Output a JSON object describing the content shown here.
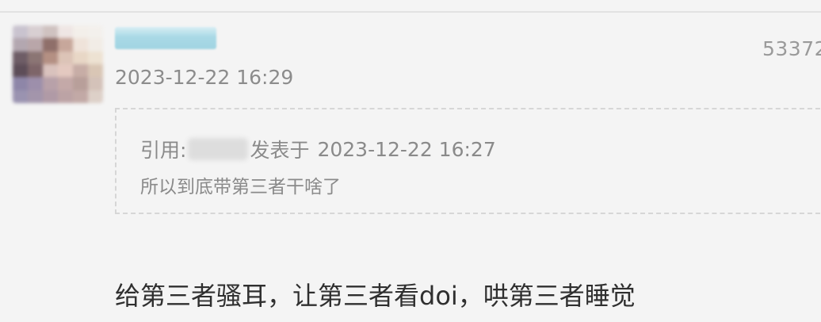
{
  "post": {
    "time": "2023-12-22 16:29",
    "floor": "53372",
    "reply": "给第三者骚耳，让第三者看doi，哄第三者睡觉"
  },
  "quote": {
    "prefix": "引用:",
    "posted_at_label": "发表于",
    "date": "2023-12-22 16:27",
    "text": "所以到底带第三者干啥了"
  },
  "colors": {
    "background": "#f4f4f4",
    "username_redaction": "#a9d9e6",
    "meta_text": "#8c8c8c",
    "body_text": "#2f2f2f"
  },
  "avatar_pixels": [
    "#c9c3cf",
    "#d8cfd2",
    "#cfc2c0",
    "#efe6e4",
    "#f3efea",
    "#f3f0ec",
    "#b3a7b0",
    "#b9a6a9",
    "#8f6f6a",
    "#c7a79b",
    "#efe3da",
    "#f1ece6",
    "#6e5d66",
    "#8b7574",
    "#b49083",
    "#dcc4b7",
    "#e8d7c6",
    "#ede2d2",
    "#5d4d58",
    "#7e6569",
    "#d9c2bd",
    "#e4c9c0",
    "#c7ada6",
    "#d9c6b5",
    "#8e86a8",
    "#9d8fab",
    "#b8a1a9",
    "#c4a9a8",
    "#b89f9a",
    "#d4c2b9",
    "#9a93b0",
    "#a395ab",
    "#b09aa6",
    "#bca3a5",
    "#c2a9a6",
    "#ddd0c8"
  ]
}
